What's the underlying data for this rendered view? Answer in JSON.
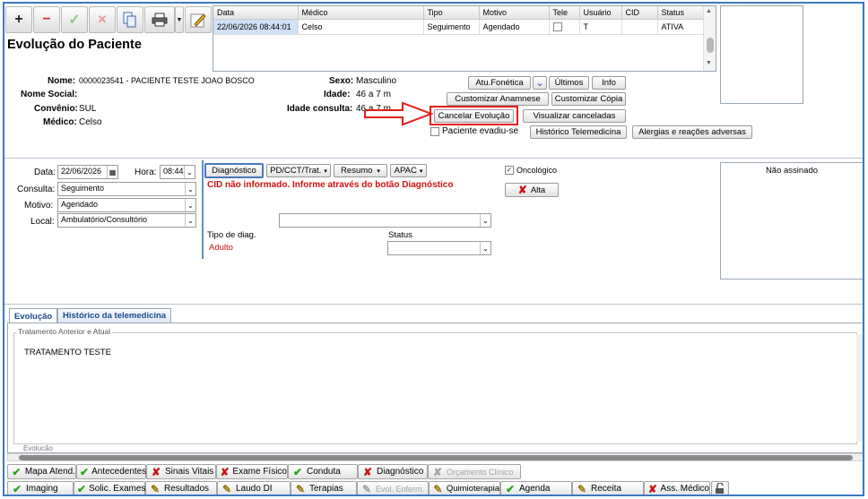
{
  "title": "Evolução do Paciente",
  "toolbar": {
    "add": "+",
    "remove": "−",
    "confirm": "✓",
    "cancel": "✕"
  },
  "evolutions_table": {
    "columns": [
      "Data",
      "Médico",
      "Tipo",
      "Motivo",
      "Tele",
      "Usuário",
      "CID",
      "Status"
    ],
    "rows": [
      [
        "22/06/2026 08:44:01",
        "Celso",
        "Seguimento",
        "Agendado",
        "",
        "T",
        "",
        "ATIVA"
      ]
    ]
  },
  "patient": {
    "nome_label": "Nome:",
    "nome": "0000023541 - PACIENTE TESTE JOAO BOSCO",
    "nome_social_label": "Nome Social:",
    "nome_social": "",
    "convenio_label": "Convênio:",
    "convenio": "SUL",
    "medico_label": "Médico:",
    "medico": "Celso",
    "sexo_label": "Sexo:",
    "sexo": "Masculino",
    "idade_label": "Idade:",
    "idade": "46 a 7 m",
    "idade_consulta_label": "Idade consulta:",
    "idade_consulta": "46 a 7 m"
  },
  "actions": {
    "atu_fonetica": "Atu.Fonética",
    "ultimos": "Últimos",
    "info": "Info",
    "customizar_anamnese": "Customizar Anamnese",
    "customizar_copia": "Customizar Cópia",
    "cancelar_evolucao": "Cancelar Evolução",
    "visualizar_canceladas": "Visualizar canceladas",
    "paciente_evadiu": "Paciente evadiu-se",
    "historico_telemedicina": "Histórico Telemedicina",
    "alergias": "Alergias e reações adversas"
  },
  "form": {
    "data_label": "Data:",
    "data": "22/06/2026",
    "hora_label": "Hora:",
    "hora": "08:44",
    "consulta_label": "Consulta:",
    "consulta": "Seguimento",
    "motivo_label": "Motivo:",
    "motivo": "Agendado",
    "local_label": "Local:",
    "local": "Ambulatório/Consultório"
  },
  "diag_toolbar": {
    "diagnostico": "Diagnóstico",
    "pd": "PD/CCT/Trat.",
    "resumo": "Resumo",
    "apac": "APAC"
  },
  "cid_warning": "CID não informado. Informe através do botão Diagnóstico",
  "tipo_diag_label": "Tipo de diag.",
  "tipo_diag_value": "Adulto",
  "status_label": "Status",
  "oncologico_label": "Oncológico",
  "alta_label": "Alta",
  "signature_status": "Não assinado",
  "tabs": [
    "Evolução",
    "Histórico da telemedicina"
  ],
  "fieldset_legend": "Tratamento Anterior e Atual",
  "fieldset_text": "TRATAMENTO TESTE",
  "fieldset2_legend": "Evolução",
  "bottom_row1": [
    "Mapa Atend.",
    "Antecedentes",
    "Sinais Vitais",
    "Exame Físico",
    "Conduta",
    "Diagnóstico",
    "Orçamento Clínico"
  ],
  "bottom_row2": [
    "Imaging",
    "Solic. Exames",
    "Resultados",
    "Laudo DI",
    "Terapias",
    "Evol. Enferm.",
    "Quimioterapia",
    "Agenda",
    "Receita",
    "Ass. Médico"
  ],
  "colors": {
    "accent": "#3b78c4",
    "highlight_red": "#e0201c",
    "warning_text": "#d01010",
    "selected_row": "#cfe0f7"
  }
}
